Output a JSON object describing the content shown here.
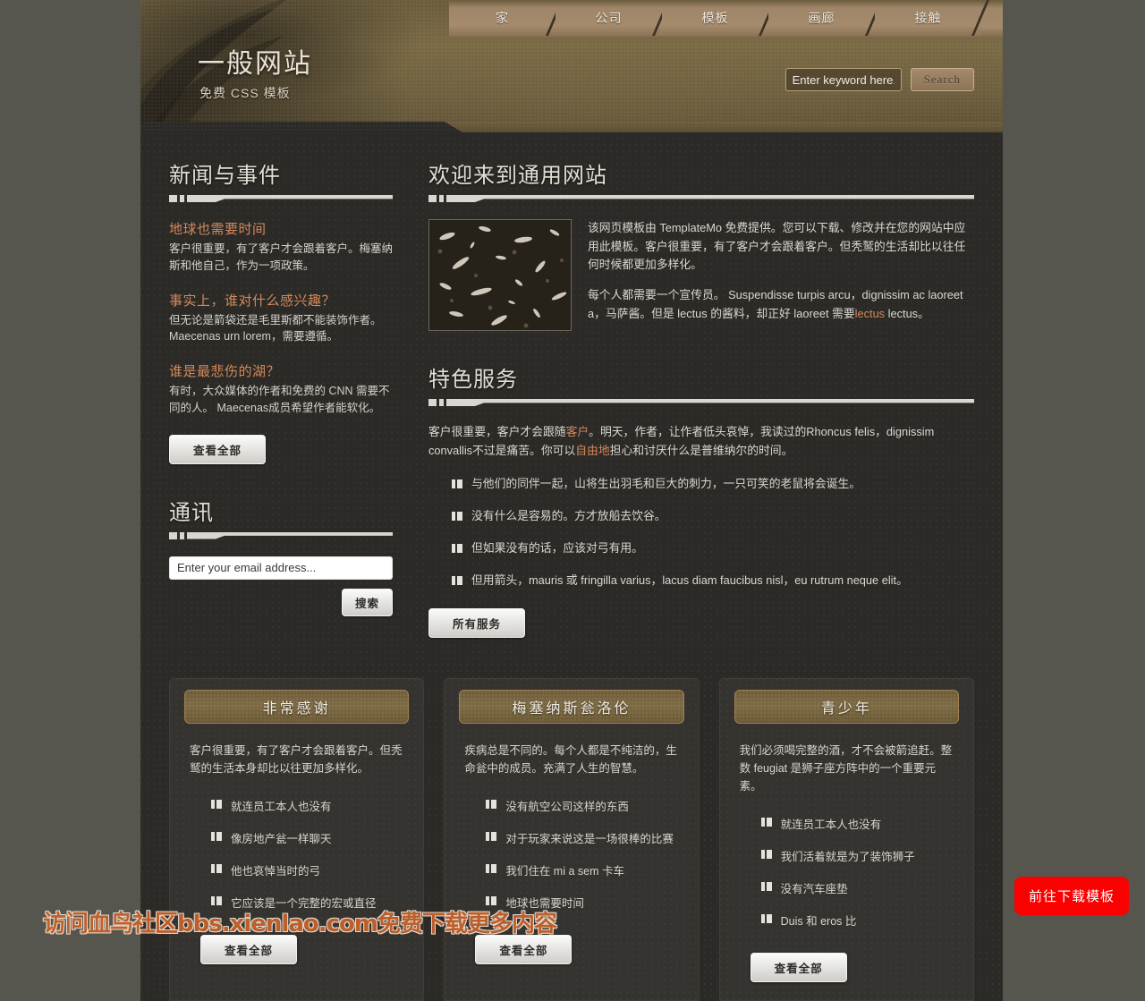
{
  "site": {
    "title": "一般网站",
    "tagline": "免费 CSS 模板"
  },
  "nav": {
    "items": [
      {
        "label": "家"
      },
      {
        "label": "公司"
      },
      {
        "label": "模板"
      },
      {
        "label": "画廊"
      },
      {
        "label": "接触"
      }
    ]
  },
  "search": {
    "placeholder": "Enter keyword here...",
    "button": "Search"
  },
  "news": {
    "heading": "新闻与事件",
    "items": [
      {
        "title": "地球也需要时间",
        "body": "客户很重要，有了客户才会跟着客户。梅塞纳斯和他自己，作为一项政策。"
      },
      {
        "title": "事实上，谁对什么感兴趣？",
        "body": "但无论是箭袋还是毛里斯都不能装饰作者。Maecenas urn lorem，需要遵循。"
      },
      {
        "title": "谁是最悲伤的湖？",
        "body": "有时，大众媒体的作者和免费的 CNN 需要不同的人。 Maecenas成员希望作者能软化。"
      }
    ],
    "more_button": "查看全部"
  },
  "newsletter": {
    "heading": "通讯",
    "placeholder": "Enter your email address...",
    "button": "搜索"
  },
  "welcome": {
    "heading": "欢迎来到通用网站",
    "para1": "该网页模板由 TemplateMo 免费提供。您可以下载、修改并在您的网站中应用此模板。客户很重要，有了客户才会跟着客户。但秃鹫的生活却比以往任何时候都更加多样化。",
    "para2_a": "每个人都需要一个宣传员。 Suspendisse turpis arcu，dignissim ac laoreet a，马萨酱。但是 lectus 的酱料，却正好 laoreet 需要",
    "para2_link": "lectus",
    "para2_b": " lectus。",
    "image_alt": "soil-texture-photo"
  },
  "services": {
    "heading": "特色服务",
    "intro_a": "客户很重要，客户才会跟随",
    "intro_link1": "客户",
    "intro_b": "。明天，作者，让作者低头哀悼，我读过的Rhoncus felis，dignissim convallis不过是痛苦。你可以",
    "intro_link2": "自由地",
    "intro_c": "担心和讨厌什么是普维纳尔的时间。",
    "items": [
      "与他们的同伴一起，山将生出羽毛和巨大的刺力，一只可笑的老鼠将会诞生。",
      "没有什么是容易的。方才放船去饮谷。",
      "但如果没有的话，应该对弓有用。",
      "但用箭头，mauris 或 fringilla varius，lacus diam faucibus nisl，eu rutrum neque elit。"
    ],
    "button": "所有服务"
  },
  "boxes": [
    {
      "title": "非常感谢",
      "body": "客户很重要，有了客户才会跟着客户。但秃鹫的生活本身却比以往更加多样化。",
      "items": [
        "就连员工本人也没有",
        "像房地产瓮一样聊天",
        "他也哀悼当时的弓",
        "它应该是一个完整的宏或直径"
      ],
      "button": "查看全部"
    },
    {
      "title": "梅塞纳斯瓮洛伦",
      "body": "疾病总是不同的。每个人都是不纯洁的，生命瓮中的成员。充满了人生的智慧。",
      "items": [
        "没有航空公司这样的东西",
        "对于玩家来说这是一场很棒的比赛",
        "我们住在 mi a sem 卡车",
        "地球也需要时间"
      ],
      "button": "查看全部"
    },
    {
      "title": "青少年",
      "body": "我们必须喝完整的酒，才不会被箭追赶。整数 feugiat 是狮子座方阵中的一个重要元素。",
      "items": [
        "就连员工本人也没有",
        "我们活着就是为了装饰狮子",
        "没有汽车座垫",
        "Duis 和 eros 比"
      ],
      "button": "查看全部"
    }
  ],
  "overlay": {
    "watermark": "访问血鸟社区bbs.xienlao.com免费下载更多内容",
    "download_button": "前往下载模板"
  },
  "colors": {
    "accent": "#d4895a",
    "page_bg": "#2b2a27",
    "body_bg": "#56564f",
    "header_brown": "#6e5f3e",
    "nav_tab": "#a58a6c",
    "download_red": "#fb0000"
  }
}
